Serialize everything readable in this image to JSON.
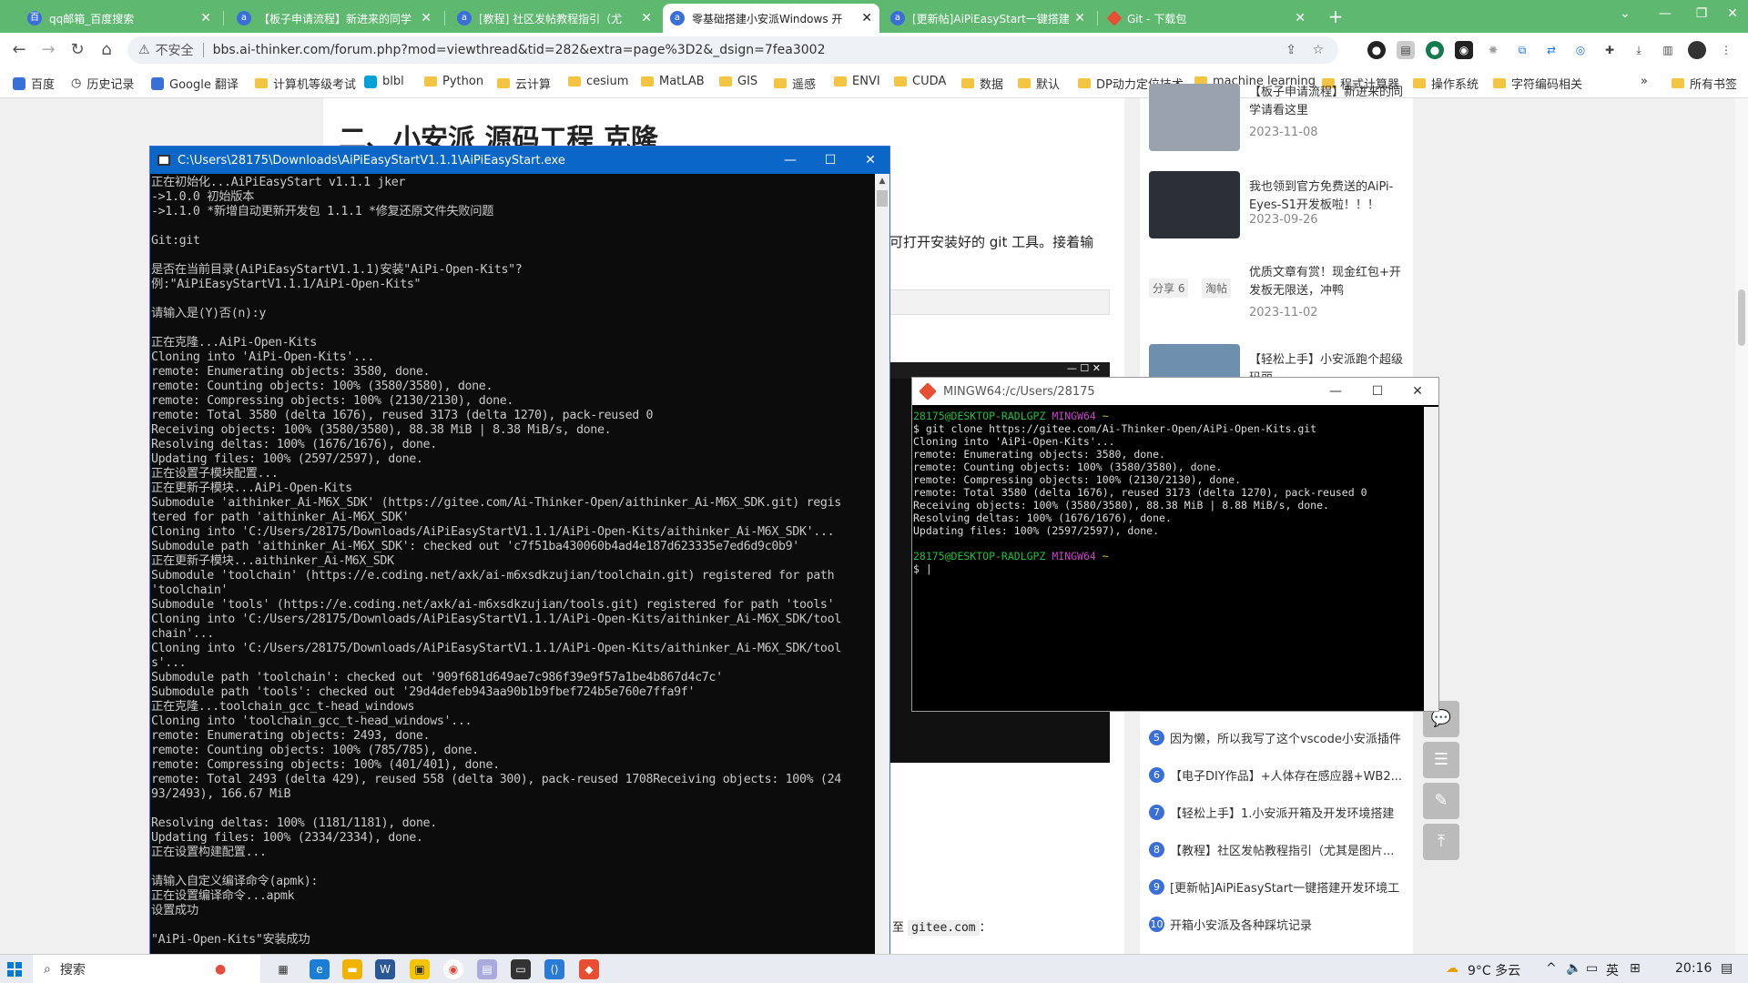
{
  "browser": {
    "tabs": [
      {
        "label": "qq邮箱_百度搜索",
        "icon": "baidu-icon",
        "active": false
      },
      {
        "label": "【板子申请流程】新进来的同学",
        "icon": "forum-icon",
        "active": false
      },
      {
        "label": "[教程] 社区发帖教程指引（尤",
        "icon": "forum-icon",
        "active": false
      },
      {
        "label": "零基础搭建小安派Windows 开",
        "icon": "forum-icon",
        "active": true
      },
      {
        "label": "[更新帖]AiPiEasyStart一键搭建",
        "icon": "forum-icon",
        "active": false
      },
      {
        "label": "Git - 下载包",
        "icon": "git-icon",
        "active": false
      }
    ],
    "new_tab": "+",
    "address": {
      "security_label": "不安全",
      "url": "bbs.ai-thinker.com/forum.php?mod=viewthread&tid=282&extra=page%3D2&_dsign=7fea3002"
    },
    "bookmarks": [
      {
        "label": "百度",
        "kind": "site"
      },
      {
        "label": "历史记录",
        "kind": "site"
      },
      {
        "label": "Google 翻译",
        "kind": "site"
      },
      {
        "label": "计算机等级考试",
        "kind": "folder"
      },
      {
        "label": "blbl",
        "kind": "site"
      },
      {
        "label": "Python",
        "kind": "folder"
      },
      {
        "label": "云计算",
        "kind": "folder"
      },
      {
        "label": "cesium",
        "kind": "folder"
      },
      {
        "label": "MatLAB",
        "kind": "folder"
      },
      {
        "label": "GIS",
        "kind": "folder"
      },
      {
        "label": "遥感",
        "kind": "folder"
      },
      {
        "label": "ENVI",
        "kind": "folder"
      },
      {
        "label": "CUDA",
        "kind": "folder"
      },
      {
        "label": "数据",
        "kind": "folder"
      },
      {
        "label": "默认",
        "kind": "folder"
      },
      {
        "label": "DP动力定位技术",
        "kind": "folder"
      },
      {
        "label": "machine learning",
        "kind": "folder"
      },
      {
        "label": "程式计算器",
        "kind": "folder"
      },
      {
        "label": "操作系统",
        "kind": "folder"
      },
      {
        "label": "字符编码相关",
        "kind": "folder"
      }
    ],
    "bookmarks_more": "»",
    "all_bookmarks": "所有书签"
  },
  "article": {
    "heading": "二、小安派 源码工程 克隆",
    "snippet": "可打开安装好的 git 工具。接着输",
    "snippet2_prefix": "至",
    "snippet2_code": "gitee.com",
    "snippet2_suffix": "："
  },
  "sidebar": {
    "cards": [
      {
        "title": "【板子申请流程】新进来的同学请看这里",
        "date": "2023-11-08"
      },
      {
        "title": "我也领到官方免费送的AiPi-Eyes-S1开发板啦！！！",
        "date": "2023-09-26"
      },
      {
        "title": "优质文章有赏！现金红包+开发板无限送，冲鸭",
        "date": "2023-11-02",
        "tags": [
          "分享 6",
          "淘帖"
        ]
      },
      {
        "title": "【轻松上手】小安派跑个超级玛丽",
        "date": ""
      }
    ],
    "ranking": [
      {
        "num": "5",
        "title": "因为懒，所以我写了这个vscode小安派插件"
      },
      {
        "num": "6",
        "title": "【电子DIY作品】+人体存在感应器+WB2..."
      },
      {
        "num": "7",
        "title": "【轻松上手】1.小安派开箱及开发环境搭建"
      },
      {
        "num": "8",
        "title": "【教程】社区发帖教程指引（尤其是图片..."
      },
      {
        "num": "9",
        "title": "[更新帖]AiPiEasyStart一键搭建开发环境工"
      },
      {
        "num": "10",
        "title": "开箱小安派及各种踩坑记录"
      }
    ]
  },
  "cmd_window": {
    "title": "C:\\Users\\28175\\Downloads\\AiPiEasyStartV1.1.1\\AiPiEasyStart.exe",
    "lines": [
      "正在初始化...AiPiEasyStart v1.1.1 jker",
      "->1.0.0 初始版本",
      "->1.1.0 *新增自动更新开发包 1.1.1 *修复还原文件失败问题",
      "",
      "Git:git",
      "",
      "是否在当前目录(AiPiEasyStartV1.1.1)安装\"AiPi-Open-Kits\"?",
      "例:\"AiPiEasyStartV1.1.1/AiPi-Open-Kits\"",
      "",
      "请输入是(Y)否(n):y",
      "",
      "正在克隆...AiPi-Open-Kits",
      "Cloning into 'AiPi-Open-Kits'...",
      "remote: Enumerating objects: 3580, done.",
      "remote: Counting objects: 100% (3580/3580), done.",
      "remote: Compressing objects: 100% (2130/2130), done.",
      "remote: Total 3580 (delta 1676), reused 3173 (delta 1270), pack-reused 0",
      "Receiving objects: 100% (3580/3580), 88.38 MiB | 8.38 MiB/s, done.",
      "Resolving deltas: 100% (1676/1676), done.",
      "Updating files: 100% (2597/2597), done.",
      "正在设置子模块配置...",
      "正在更新子模块...AiPi-Open-Kits",
      "Submodule 'aithinker_Ai-M6X_SDK' (https://gitee.com/Ai-Thinker-Open/aithinker_Ai-M6X_SDK.git) regis",
      "tered for path 'aithinker_Ai-M6X_SDK'",
      "Cloning into 'C:/Users/28175/Downloads/AiPiEasyStartV1.1.1/AiPi-Open-Kits/aithinker_Ai-M6X_SDK'...",
      "Submodule path 'aithinker_Ai-M6X_SDK': checked out 'c7f51ba430060b4ad4e187d623335e7ed6d9c0b9'",
      "正在更新子模块...aithinker_Ai-M6X_SDK",
      "Submodule 'toolchain' (https://e.coding.net/axk/ai-m6xsdkzujian/toolchain.git) registered for path",
      "'toolchain'",
      "Submodule 'tools' (https://e.coding.net/axk/ai-m6xsdkzujian/tools.git) registered for path 'tools'",
      "Cloning into 'C:/Users/28175/Downloads/AiPiEasyStartV1.1.1/AiPi-Open-Kits/aithinker_Ai-M6X_SDK/tool",
      "chain'...",
      "Cloning into 'C:/Users/28175/Downloads/AiPiEasyStartV1.1.1/AiPi-Open-Kits/aithinker_Ai-M6X_SDK/tool",
      "s'...",
      "Submodule path 'toolchain': checked out '909f681d649ae7c986f39e9f57a1be4b867d4c7c'",
      "Submodule path 'tools': checked out '29d4defeb943aa90b1b9fbef724b5e760e7ffa9f'",
      "正在克隆...toolchain_gcc_t-head_windows",
      "Cloning into 'toolchain_gcc_t-head_windows'...",
      "remote: Enumerating objects: 2493, done.",
      "remote: Counting objects: 100% (785/785), done.",
      "remote: Compressing objects: 100% (401/401), done.",
      "remote: Total 2493 (delta 429), reused 558 (delta 300), pack-reused 1708Receiving objects: 100% (24",
      "93/2493), 166.67 MiB",
      "",
      "Resolving deltas: 100% (1181/1181), done.",
      "Updating files: 100% (2334/2334), done.",
      "正在设置构建配置...",
      "",
      "请输入自定义编译命令(apmk):",
      "正在设置编译命令...apmk",
      "设置成功",
      "",
      "\"AiPi-Open-Kits\"安装成功"
    ]
  },
  "mingw_window": {
    "title": "MINGW64:/c/Users/28175",
    "prompt_user": "28175@DESKTOP-RADLGPZ",
    "prompt_env": "MINGW64",
    "prompt_dir": "~",
    "command": "$ git clone https://gitee.com/Ai-Thinker-Open/AiPi-Open-Kits.git",
    "output": [
      "Cloning into 'AiPi-Open-Kits'...",
      "remote: Enumerating objects: 3580, done.",
      "remote: Counting objects: 100% (3580/3580), done.",
      "remote: Compressing objects: 100% (2130/2130), done.",
      "remote: Total 3580 (delta 1676), reused 3173 (delta 1270), pack-reused 0",
      "Receiving objects: 100% (3580/3580), 88.38 MiB | 8.88 MiB/s, done.",
      "Resolving deltas: 100% (1676/1676), done.",
      "Updating files: 100% (2597/2597), done."
    ],
    "cursor_line": "$ |"
  },
  "taskbar": {
    "search_label": "搜索",
    "weather": "9°C 多云",
    "ime": "英",
    "time": "20:16"
  }
}
